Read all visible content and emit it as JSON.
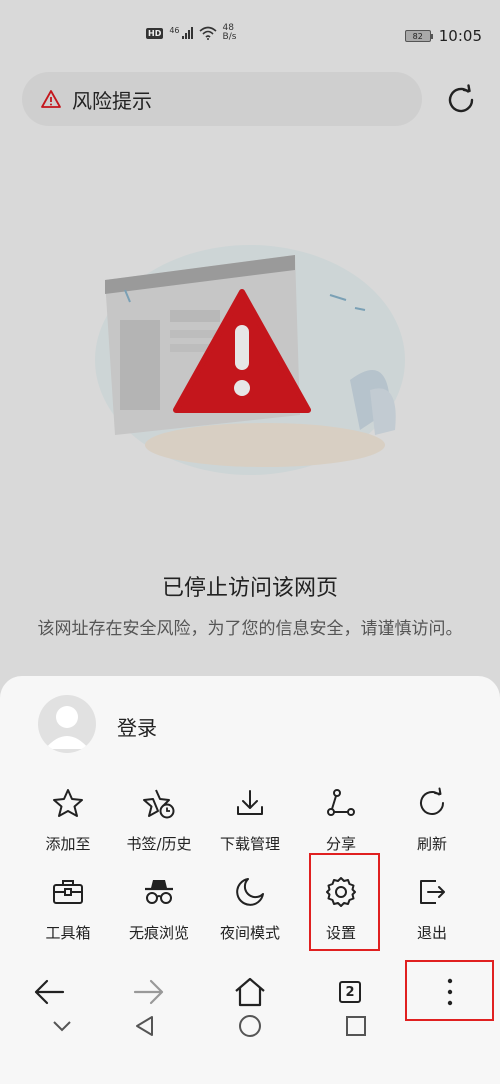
{
  "status_bar": {
    "network_badge": "HD",
    "network_type": "46",
    "speed_value": "48",
    "speed_unit": "B/s",
    "battery": "82",
    "time": "10:05"
  },
  "risk_bar": {
    "label": "风险提示"
  },
  "blocked_page": {
    "title": "已停止访问该网页",
    "description": "该网址存在安全风险，为了您的信息安全，请谨慎访问。"
  },
  "menu": {
    "login_label": "登录",
    "items": [
      {
        "label": "添加至",
        "icon": "star-icon"
      },
      {
        "label": "书签/历史",
        "icon": "bookmark-history-icon"
      },
      {
        "label": "下载管理",
        "icon": "download-icon"
      },
      {
        "label": "分享",
        "icon": "share-icon"
      },
      {
        "label": "刷新",
        "icon": "refresh-icon"
      },
      {
        "label": "工具箱",
        "icon": "toolbox-icon"
      },
      {
        "label": "无痕浏览",
        "icon": "incognito-icon"
      },
      {
        "label": "夜间模式",
        "icon": "moon-icon"
      },
      {
        "label": "设置",
        "icon": "gear-icon"
      },
      {
        "label": "退出",
        "icon": "exit-icon"
      }
    ]
  },
  "bottom_nav": {
    "tab_count": "2"
  },
  "colors": {
    "highlight": "#e02020",
    "warning_red": "#c4161c"
  }
}
